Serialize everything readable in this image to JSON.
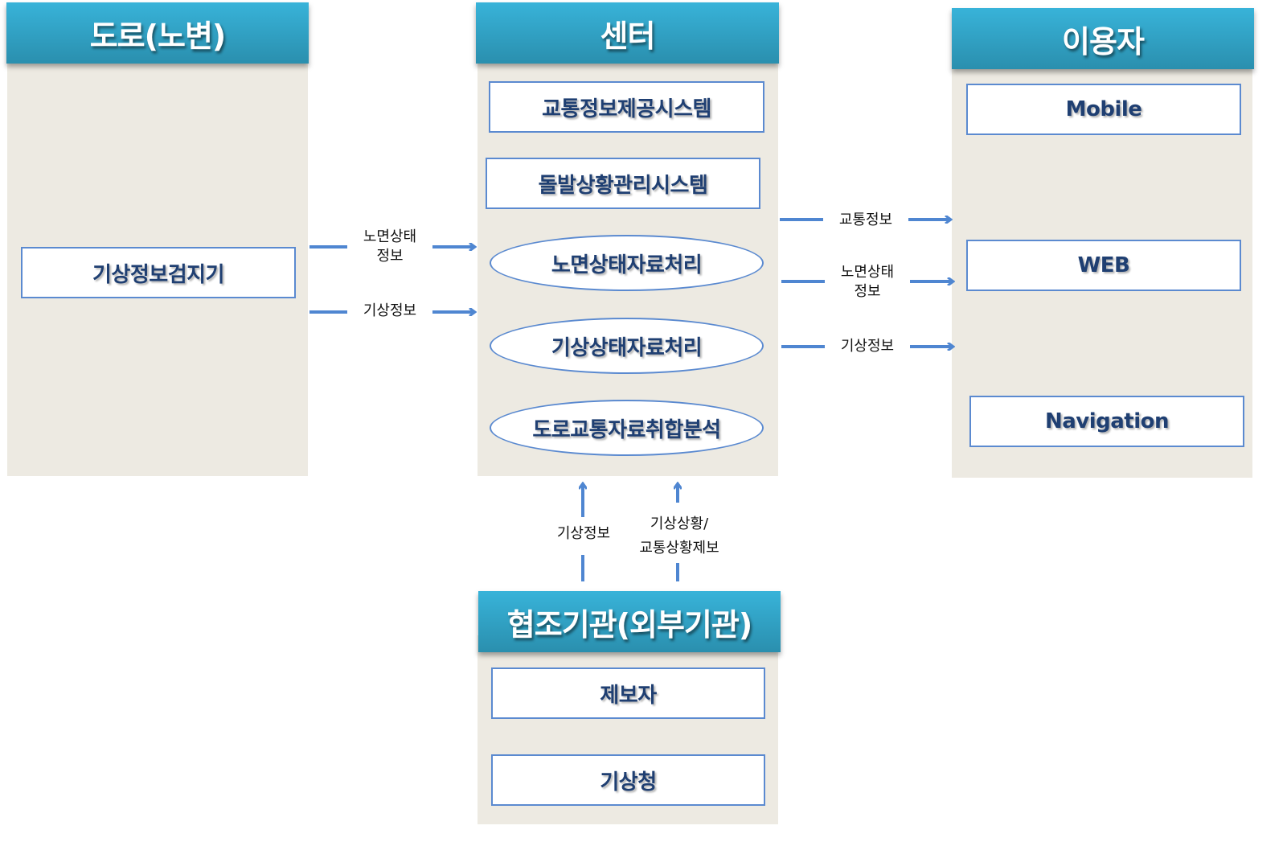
{
  "columns": {
    "road": {
      "title": "도로(노변)",
      "items": [
        "기상정보검지기"
      ]
    },
    "center": {
      "title": "센터",
      "systems": [
        "교통정보제공시스템",
        "돌발상황관리시스템"
      ],
      "processes": [
        "노면상태자료처리",
        "기상상태자료처리",
        "도로교통자료취합분석"
      ]
    },
    "user": {
      "title": "이용자",
      "items": [
        "Mobile",
        "WEB",
        "Navigation"
      ]
    },
    "partner": {
      "title": "협조기관(외부기관)",
      "items": [
        "제보자",
        "기상청"
      ]
    }
  },
  "flows": {
    "road_to_center": [
      "노면상태\n정보",
      "기상정보"
    ],
    "center_to_user": [
      "교통정보",
      "노면상태\n정보",
      "기상정보"
    ],
    "partner_to_center": [
      "기상정보",
      "기상상황/\n교통상황제보"
    ]
  },
  "colors": {
    "header": "#2fa3c9",
    "panel": "#edeae2",
    "box_border": "#5b8ad0",
    "box_text": "#1f3f72",
    "arrow": "#4f86d1"
  }
}
